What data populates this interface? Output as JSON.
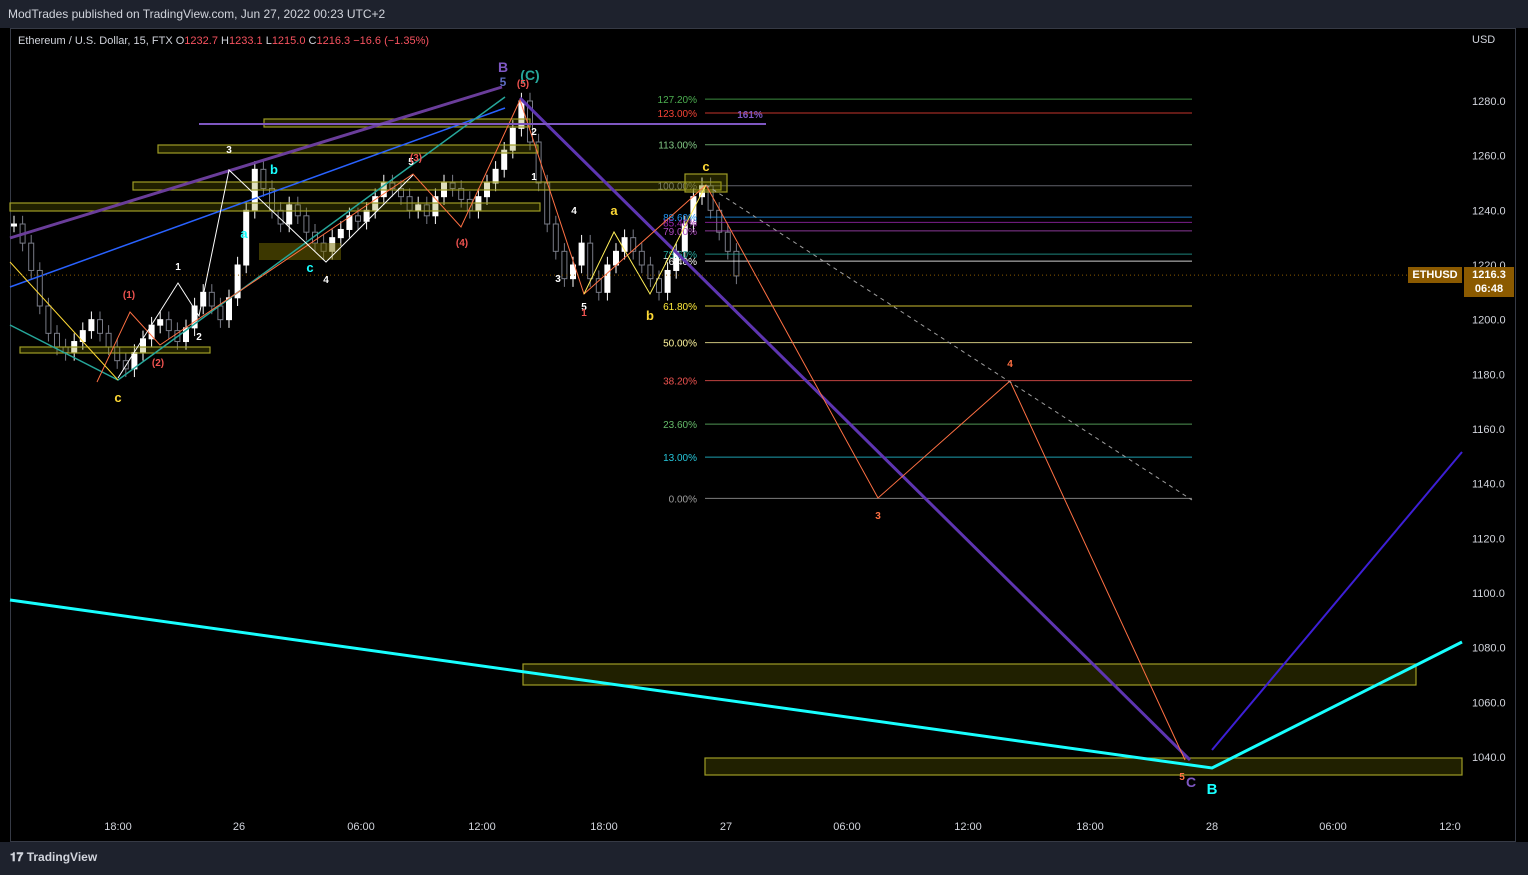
{
  "header": {
    "published": "ModTrades published on TradingView.com, Jun 27, 2022 00:23 UTC+2"
  },
  "legend": {
    "symbol": "Ethereum / U.S. Dollar, 15, FTX",
    "o_label": "O",
    "o_val": "1232.7",
    "h_label": "H",
    "h_val": "1233.1",
    "l_label": "L",
    "l_val": "1215.0",
    "c_label": "C",
    "c_val": "1216.3",
    "change": "−16.6 (−1.35%)"
  },
  "axis": {
    "currency": "USD"
  },
  "price_badge": {
    "ticker": "ETHUSD",
    "price": "1216.3",
    "countdown": "06:48"
  },
  "footer": {
    "brand": "TradingView"
  },
  "chart_data": {
    "type": "candlestick",
    "symbol": "ETHUSD",
    "y_ticks": [
      1280.0,
      1260.0,
      1240.0,
      1220.0,
      1200.0,
      1180.0,
      1160.0,
      1140.0,
      1120.0,
      1100.0,
      1080.0,
      1060.0,
      1040.0
    ],
    "x_ticks": [
      "18:00",
      "26",
      "06:00",
      "12:00",
      "18:00",
      "27",
      "06:00",
      "12:00",
      "18:00",
      "28",
      "06:00",
      "12:0"
    ],
    "fib_levels": [
      {
        "label": "127.20%",
        "price": 1280.7,
        "color": "#4caf50"
      },
      {
        "label": "123.00%",
        "price": 1275.6,
        "color": "#f44336"
      },
      {
        "label": "113.00%",
        "price": 1264.0,
        "color": "#81c784"
      },
      {
        "label": "100.00%",
        "price": 1249.0,
        "color": "#787b86"
      },
      {
        "label": "88.60%",
        "price": 1237.5,
        "color": "#2196f3"
      },
      {
        "label": "85.40%",
        "price": 1235.6,
        "color": "#9c27b0"
      },
      {
        "label": "79.00%",
        "price": 1232.5,
        "color": "#ab47bc"
      },
      {
        "label": "78.60%",
        "price": 1224.0,
        "color": "#26a69a"
      },
      {
        "label": "76.40%",
        "price": 1221.4,
        "color": "#ffffff"
      },
      {
        "label": "61.80%",
        "price": 1205.0,
        "color": "#ffeb3b"
      },
      {
        "label": "50.00%",
        "price": 1191.6,
        "color": "#fff59d"
      },
      {
        "label": "38.20%",
        "price": 1177.7,
        "color": "#ef5350"
      },
      {
        "label": "23.60%",
        "price": 1161.8,
        "color": "#66bb6a"
      },
      {
        "label": "13.00%",
        "price": 1149.7,
        "color": "#26c6da"
      },
      {
        "label": "0.00%",
        "price": 1134.6,
        "color": "#9e9e9e"
      }
    ],
    "annotations": [
      "B",
      "5",
      "(C)",
      "(5)",
      "161%",
      "c",
      "a",
      "b",
      "1",
      "2",
      "3",
      "4",
      "5",
      "(1)",
      "(2)",
      "(3)",
      "(4)",
      "3",
      "4",
      "C",
      "B"
    ]
  }
}
